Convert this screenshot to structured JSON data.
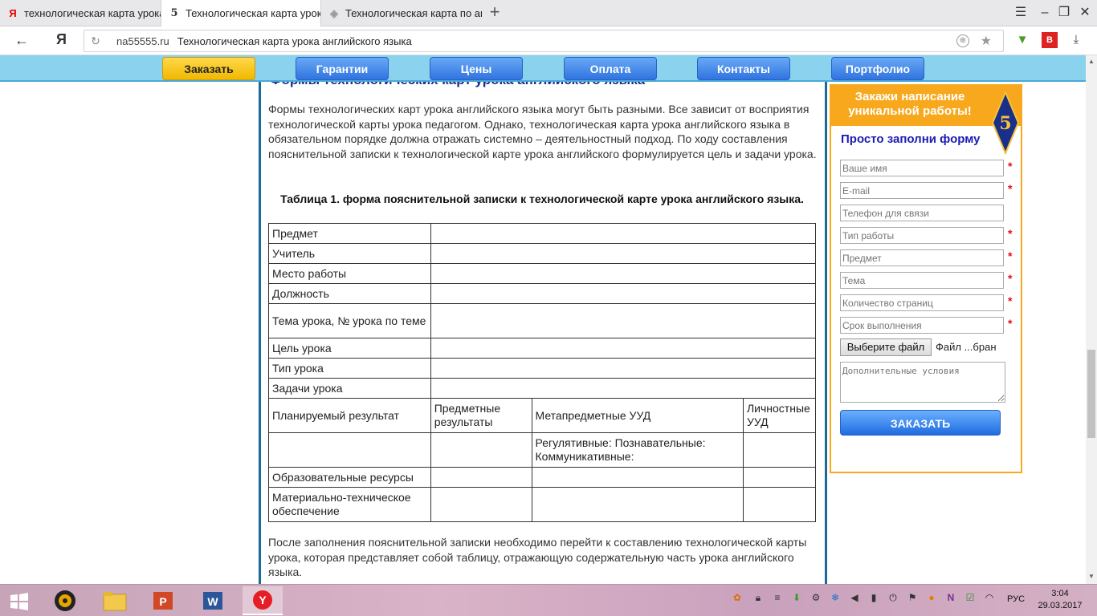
{
  "browser": {
    "tabs": [
      {
        "title": "технологическая карта урока англ",
        "favicon": "yandex-icon"
      },
      {
        "title": "Технологическая карта урока английского языка",
        "favicon": "site-5-icon"
      },
      {
        "title": "Технологическая карта по англ",
        "favicon": "page-icon"
      }
    ],
    "new_tab_label": "+",
    "address": {
      "domain": "na55555.ru",
      "page_title": "Технологическая карта урока английского языка"
    },
    "yandex_button": "Я"
  },
  "site_nav": {
    "items": [
      "Заказать",
      "Гарантии",
      "Цены",
      "Оплата",
      "Контакты",
      "Портфолио"
    ]
  },
  "article": {
    "heading": "Формы технологических карт урока английского языка",
    "intro": "Формы технологических карт урока английского языка могут быть разными. Все зависит от восприятия технологической карты урока педагогом. Однако, технологическая карта урока английского языка в обязательном порядке должна отражать системно – деятельностный подход. По ходу составления пояснительной записки к технологической карте урока английского формулируется цель и задачи урока.",
    "table_caption": "Таблица 1. форма пояснительной записки к технологической карте урока английского языка.",
    "table": {
      "simple_rows": [
        "Предмет",
        "Учитель",
        "Место работы",
        "Должность",
        "Тема урока, № урока по теме",
        "Цель урока",
        "Тип урока",
        "Задачи урока"
      ],
      "results_header": [
        "Планируемый результат",
        "Предметные результаты",
        "Метапредметные УУД",
        "Личностные УУД"
      ],
      "meta_cell": "Регулятивные: Познавательные: Коммуникативные:",
      "resources_row": "Образовательные ресурсы",
      "equipment_row": "Материально-техническое обеспечение"
    },
    "outro": "После заполнения пояснительной записки необходимо перейти к составлению технологической карты урока, которая представляет собой таблицу, отражающую содержательную часть урока английского языка."
  },
  "order_widget": {
    "title": "Закажи написание уникальной работы!",
    "badge": "5",
    "subtitle": "Просто заполни форму",
    "fields": [
      {
        "placeholder": "Ваше имя",
        "required": true
      },
      {
        "placeholder": "E-mail",
        "required": true
      },
      {
        "placeholder": "Телефон для связи",
        "required": false
      },
      {
        "placeholder": "Тип работы",
        "required": true
      },
      {
        "placeholder": "Предмет",
        "required": true
      },
      {
        "placeholder": "Тема",
        "required": true
      },
      {
        "placeholder": "Количество страниц",
        "required": true
      },
      {
        "placeholder": "Срок выполнения",
        "required": true
      }
    ],
    "required_mark": "*",
    "file_button": "Выберите файл",
    "file_status": "Файл ...бран",
    "extra_placeholder": "Дополнительные условия",
    "submit": "ЗАКАЗАТЬ"
  },
  "taskbar": {
    "language": "РУС",
    "time": "3:04",
    "date": "29.03.2017"
  },
  "colors": {
    "nav_bar": "#8ad2ee",
    "nav_button": "#2f74e0",
    "order_button": "#f0b800",
    "widget_accent": "#f7a81c",
    "heading": "#1a2f8a"
  }
}
